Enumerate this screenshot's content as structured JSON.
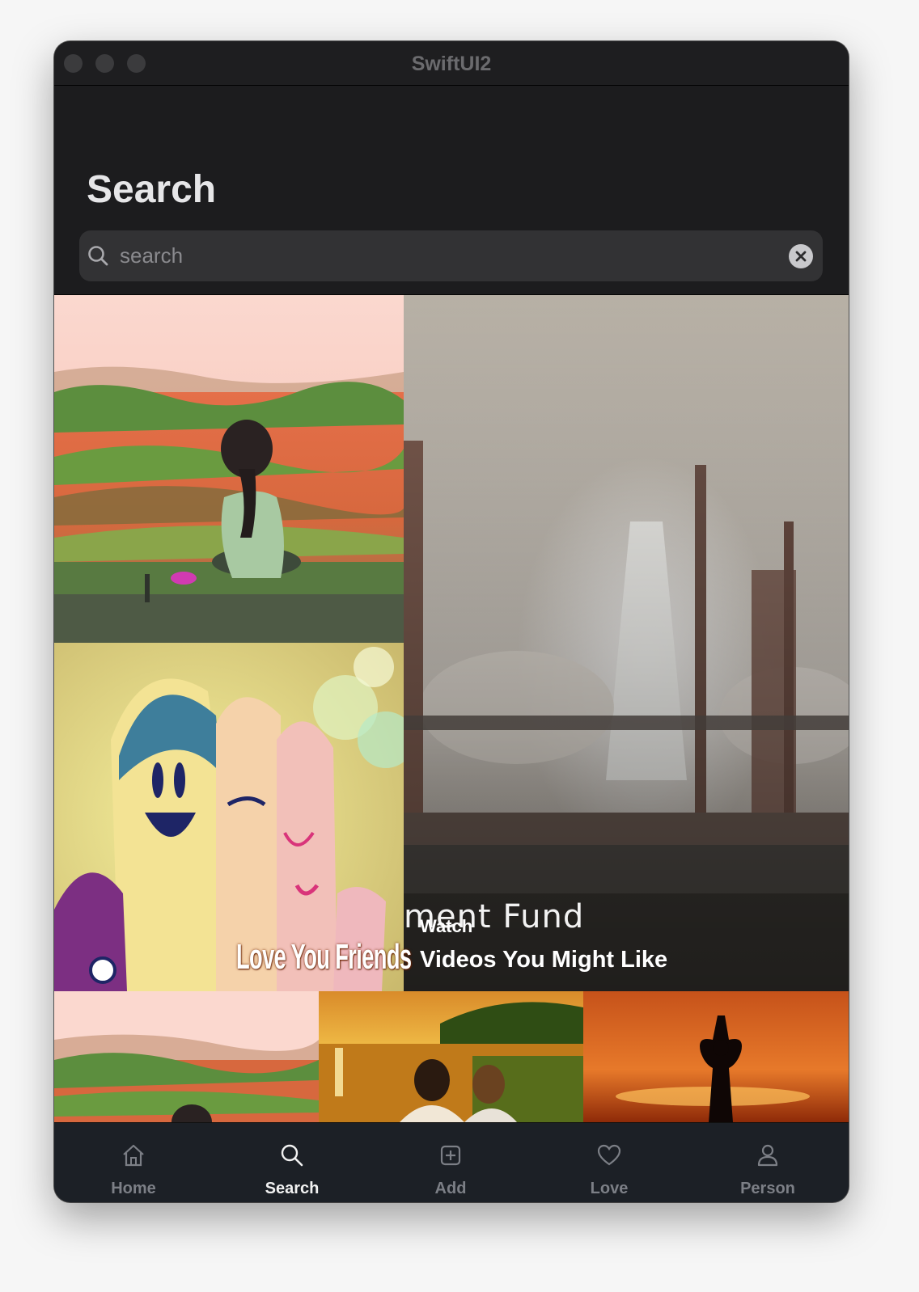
{
  "window": {
    "title": "SwiftUI2"
  },
  "header": {
    "title": "Search"
  },
  "search": {
    "placeholder": "search",
    "value": ""
  },
  "tiles": {
    "friends_caption": "Love You Friends",
    "ad_text": "ment Fund",
    "watch_label": "Watch",
    "videos_label": "Videos You Might Like"
  },
  "tabbar": {
    "active": "Search",
    "items": [
      {
        "label": "Home",
        "icon": "house-icon"
      },
      {
        "label": "Search",
        "icon": "search-icon"
      },
      {
        "label": "Add",
        "icon": "plus-square-icon"
      },
      {
        "label": "Love",
        "icon": "heart-icon"
      },
      {
        "label": "Person",
        "icon": "person-icon"
      }
    ]
  },
  "colors": {
    "window_bg": "#1c1c1e",
    "search_bg": "#323234",
    "tab_active": "#f1f1f1",
    "tab_inactive": "#7c7f86"
  }
}
